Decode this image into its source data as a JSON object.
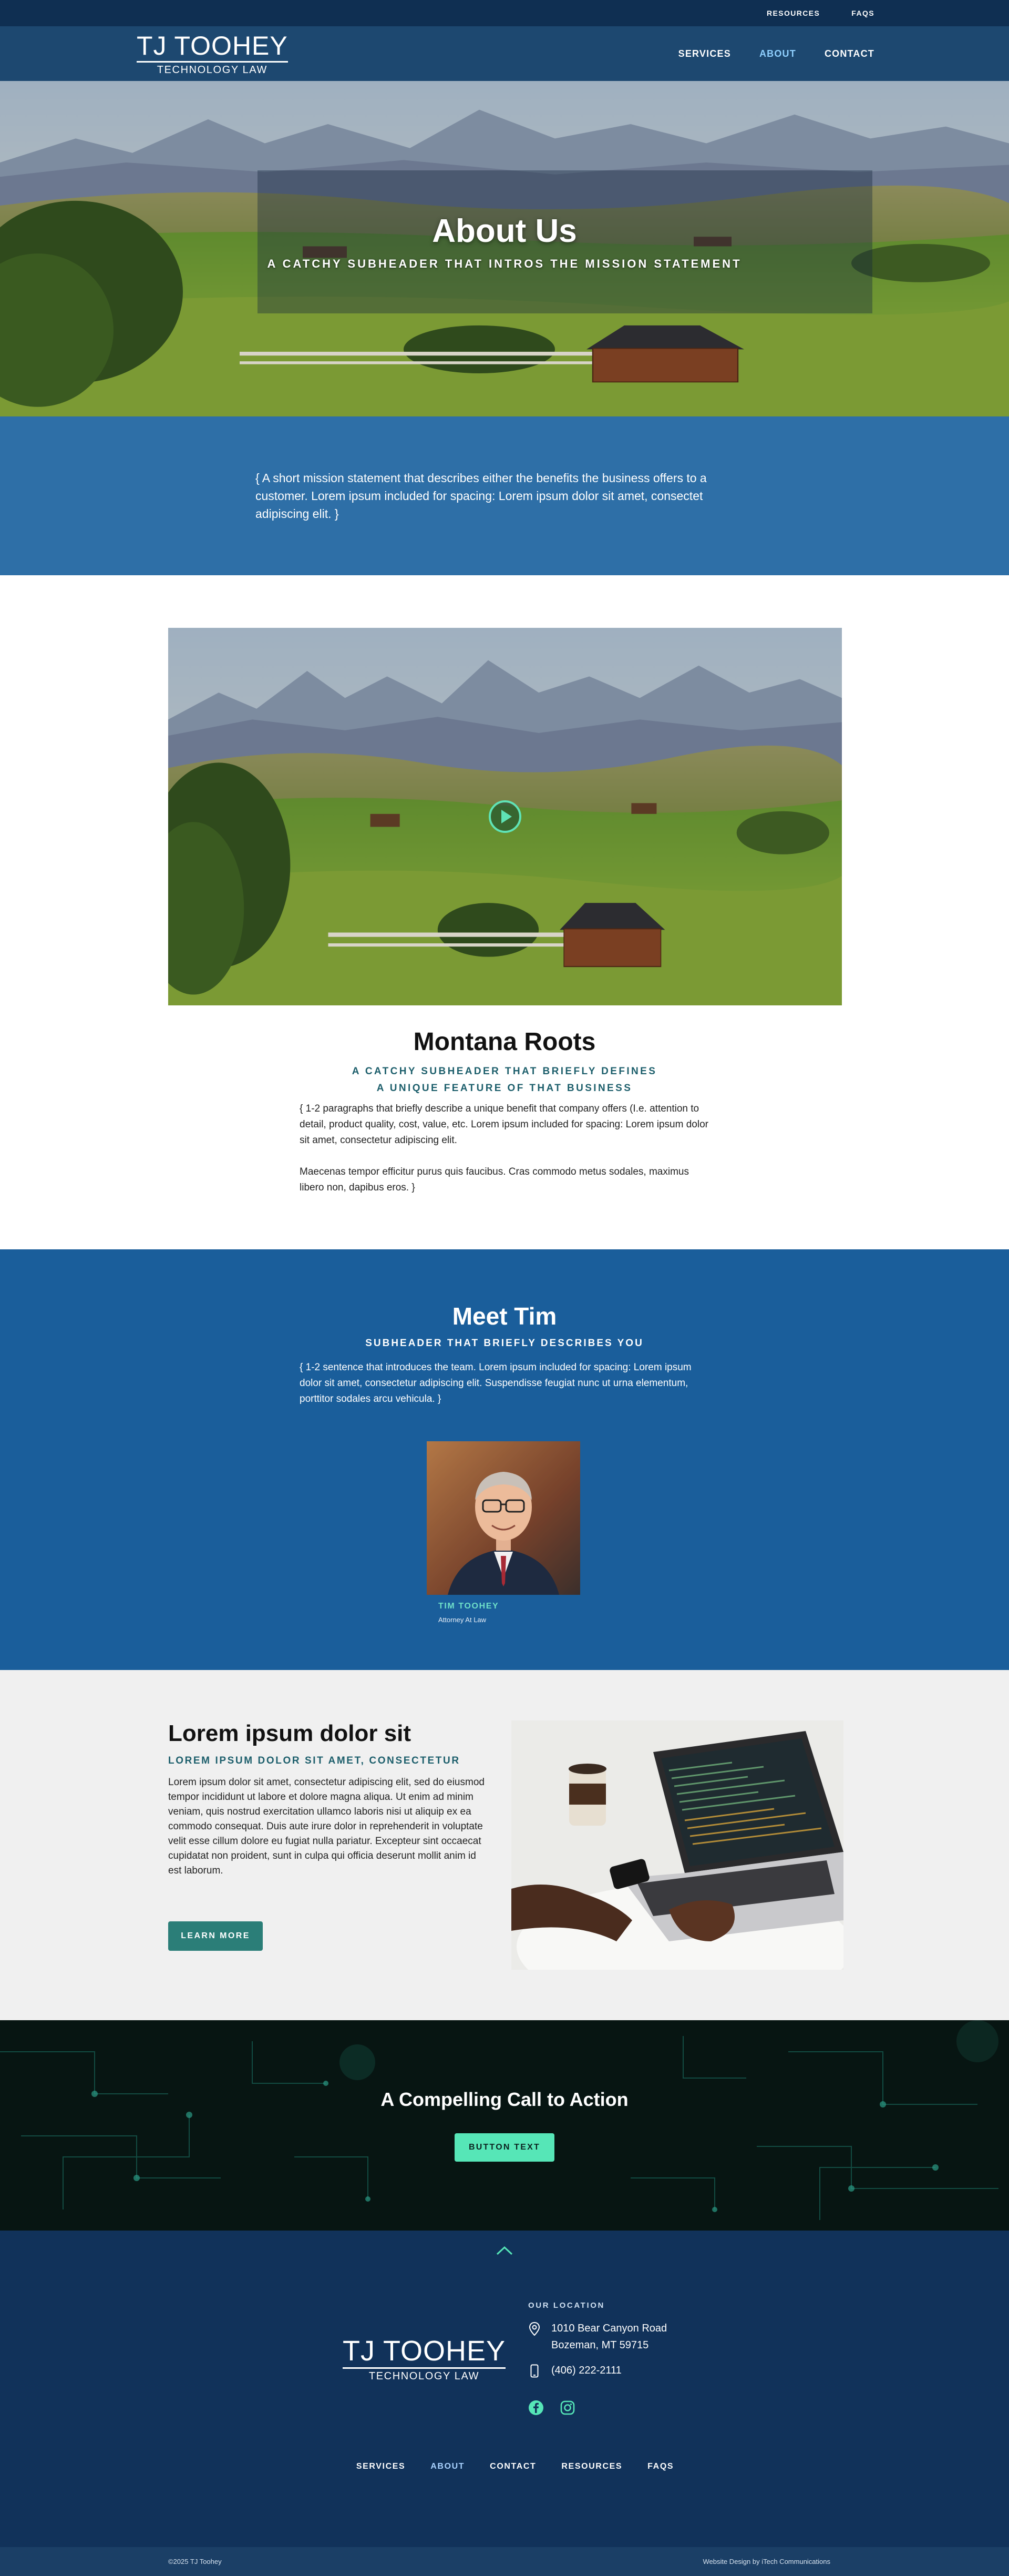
{
  "utility_nav": {
    "items": [
      "RESOURCES",
      "FAQS"
    ]
  },
  "brand": {
    "name": "TJ TOOHEY",
    "tagline": "TECHNOLOGY LAW"
  },
  "main_nav": {
    "items": [
      "SERVICES",
      "ABOUT",
      "CONTACT"
    ],
    "active": "ABOUT"
  },
  "hero": {
    "title": "About Us",
    "subtitle": "A CATCHY SUBHEADER THAT INTROS THE MISSION STATEMENT"
  },
  "mission": {
    "text": "{ A short mission statement that describes either the benefits the business offers to a customer. Lorem ipsum included for spacing: Lorem ipsum dolor sit amet, consectet adipiscing elit. }"
  },
  "montana": {
    "video_play_icon": "play-icon",
    "title": "Montana Roots",
    "subtitle": "A CATCHY SUBHEADER THAT BRIEFLY DEFINES A UNIQUE FEATURE OF THAT BUSINESS",
    "paragraph1": "{ 1-2 paragraphs that briefly describe a unique benefit that company offers (I.e. attention to detail, product quality, cost, value, etc. Lorem ipsum included for spacing: Lorem ipsum dolor sit amet, consectetur adipiscing elit.",
    "paragraph2": "Maecenas tempor efficitur purus quis faucibus. Cras commodo metus sodales, maximus libero non, dapibus eros. }"
  },
  "team": {
    "title": "Meet Tim",
    "subtitle": "SUBHEADER THAT BRIEFLY DESCRIBES YOU",
    "intro": "{ 1-2 sentence that introduces the team. Lorem ipsum included for spacing: Lorem ipsum dolor sit amet, consectetur adipiscing elit. Suspendisse feugiat nunc ut urna elementum, porttitor sodales arcu vehicula. }",
    "member_name": "TIM TOOHEY",
    "member_role": "Attorney At Law"
  },
  "feature": {
    "title": "Lorem ipsum dolor sit",
    "subtitle": "LOREM IPSUM DOLOR SIT AMET, CONSECTETUR",
    "body": "Lorem ipsum dolor sit amet, consectetur adipiscing elit, sed do eiusmod tempor incididunt ut labore et dolore magna aliqua. Ut enim ad minim veniam, quis nostrud exercitation ullamco laboris nisi ut aliquip ex ea commodo consequat. Duis aute irure dolor in reprehenderit in voluptate velit esse cillum dolore eu fugiat nulla pariatur. Excepteur sint occaecat cupidatat non proident, sunt in culpa qui officia deserunt mollit anim id est laborum.",
    "button": "LEARN MORE"
  },
  "cta": {
    "title": "A Compelling Call to Action",
    "button": "BUTTON TEXT"
  },
  "footer": {
    "location_label": "OUR LOCATION",
    "address_line1": "1010 Bear Canyon Road",
    "address_line2": "Bozeman, MT 59715",
    "phone": "(406) 222-2111",
    "social_icons": [
      "facebook-icon",
      "instagram-icon"
    ],
    "nav": [
      "SERVICES",
      "ABOUT",
      "CONTACT",
      "RESOURCES",
      "FAQS"
    ],
    "copyright": "©2025 TJ Toohey",
    "credit": "Website Design by iTech Communications"
  },
  "colors": {
    "navy": "#0f2f52",
    "header_blue": "#1d4870",
    "mission_blue": "#2e6fa7",
    "team_blue": "#1a5e9b",
    "teal_accent": "#56e6b7",
    "teal_text": "#1c5e6b",
    "button_teal": "#2b7e78"
  }
}
